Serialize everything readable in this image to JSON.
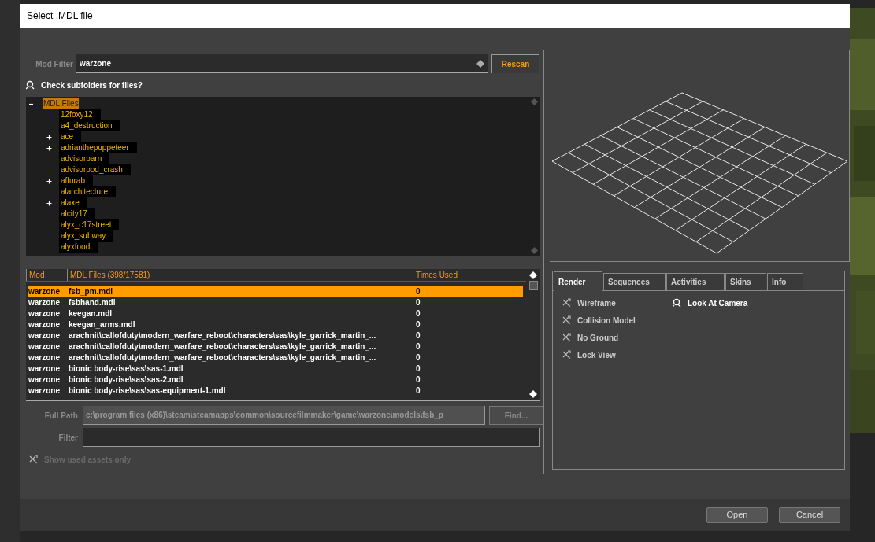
{
  "dialog": {
    "title": "Select .MDL file"
  },
  "mod_filter": {
    "label": "Mod Filter",
    "value": "warzone"
  },
  "rescan_button": "Rescan",
  "check_subfolders": {
    "label": "Check subfolders for files?",
    "checked": true
  },
  "tree": [
    {
      "label": "MDL Files",
      "expanded": true,
      "selected": true,
      "children": [
        {
          "label": "12foxy12",
          "expandable": false
        },
        {
          "label": "a4_destruction",
          "expandable": false
        },
        {
          "label": "ace",
          "expandable": true
        },
        {
          "label": "adrianthepuppeteer",
          "expandable": true
        },
        {
          "label": "advisorbarn",
          "expandable": false
        },
        {
          "label": "advisorpod_crash",
          "expandable": false
        },
        {
          "label": "affurab",
          "expandable": true
        },
        {
          "label": "alarchitecture",
          "expandable": false
        },
        {
          "label": "alaxe",
          "expandable": true
        },
        {
          "label": "alcity17",
          "expandable": false
        },
        {
          "label": "alyx_c17street",
          "expandable": false
        },
        {
          "label": "alyx_subway",
          "expandable": false
        },
        {
          "label": "alyxfood",
          "expandable": false
        }
      ]
    }
  ],
  "file_list": {
    "columns": [
      "Mod",
      "MDL Files (398/17581)",
      "Times Used"
    ],
    "rows": [
      {
        "mod": "warzone",
        "file": "fsb_pm.mdl",
        "times_used": "0",
        "selected": true
      },
      {
        "mod": "warzone",
        "file": "fsbhand.mdl",
        "times_used": "0",
        "selected": false
      },
      {
        "mod": "warzone",
        "file": "keegan.mdl",
        "times_used": "0",
        "selected": false
      },
      {
        "mod": "warzone",
        "file": "keegan_arms.mdl",
        "times_used": "0",
        "selected": false
      },
      {
        "mod": "warzone",
        "file": "arachnit\\callofduty\\modern_warfare_reboot\\characters\\sas\\kyle_garrick_martin_...",
        "times_used": "0",
        "selected": false
      },
      {
        "mod": "warzone",
        "file": "arachnit\\callofduty\\modern_warfare_reboot\\characters\\sas\\kyle_garrick_martin_...",
        "times_used": "0",
        "selected": false
      },
      {
        "mod": "warzone",
        "file": "arachnit\\callofduty\\modern_warfare_reboot\\characters\\sas\\kyle_garrick_martin_...",
        "times_used": "0",
        "selected": false
      },
      {
        "mod": "warzone",
        "file": "bionic body-rise\\sas\\sas-1.mdl",
        "times_used": "0",
        "selected": false
      },
      {
        "mod": "warzone",
        "file": "bionic body-rise\\sas\\sas-2.mdl",
        "times_used": "0",
        "selected": false
      },
      {
        "mod": "warzone",
        "file": "bionic body-rise\\sas\\sas-equipment-1.mdl",
        "times_used": "0",
        "selected": false
      }
    ]
  },
  "full_path": {
    "label": "Full Path",
    "value": "c:\\program files (x86)\\steam\\steamapps\\common\\sourcefilmmaker\\game\\warzone\\models\\fsb_p"
  },
  "find_button": {
    "label": "Find...",
    "disabled": true
  },
  "filter": {
    "label": "Filter"
  },
  "show_used_only": {
    "label": "Show used assets only",
    "checked": false
  },
  "tabs": [
    {
      "label": "Render",
      "selected": true
    },
    {
      "label": "Sequences",
      "selected": false
    },
    {
      "label": "Activities",
      "selected": false
    },
    {
      "label": "Skins",
      "selected": false
    },
    {
      "label": "Info",
      "selected": false
    }
  ],
  "render_options": [
    [
      {
        "label": "Wireframe",
        "checked": false
      },
      {
        "label": "Collision Model",
        "checked": false
      },
      {
        "label": "No Ground",
        "checked": false
      },
      {
        "label": "Lock View",
        "checked": false
      }
    ],
    [
      {
        "label": "Look At Camera",
        "checked": true
      }
    ]
  ],
  "buttons": [
    "Open",
    "Cancel"
  ]
}
